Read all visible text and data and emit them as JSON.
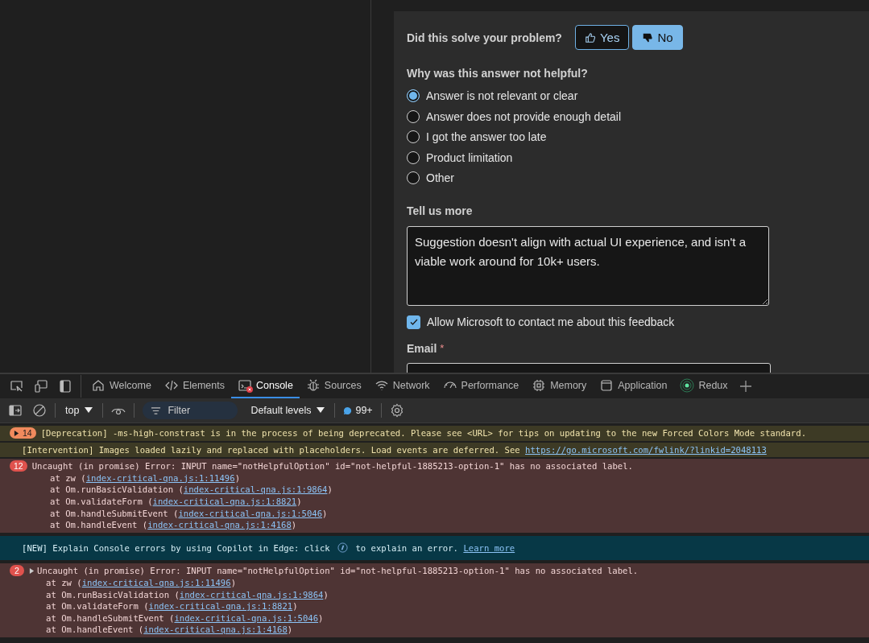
{
  "feedback": {
    "question": "Did this solve your problem?",
    "buttons": [
      {
        "label": "Yes",
        "selected": false
      },
      {
        "label": "No",
        "selected": true
      }
    ],
    "reason_prompt": "Why was this answer not helpful?",
    "reasons": [
      {
        "label": "Answer is not relevant or clear",
        "selected": true
      },
      {
        "label": "Answer does not provide enough detail",
        "selected": false
      },
      {
        "label": "I got the answer too late",
        "selected": false
      },
      {
        "label": "Product limitation",
        "selected": false
      },
      {
        "label": "Other",
        "selected": false
      }
    ],
    "more_label": "Tell us more",
    "more_value": "Suggestion doesn't align with actual UI experience, and isn't a viable work around for 10k+ users.",
    "contact": {
      "label": "Allow Microsoft to contact me about this feedback",
      "checked": true
    },
    "email_label": "Email",
    "email_required_mark": "*"
  },
  "devtools": {
    "tabs": [
      {
        "label": "Welcome",
        "selected": false,
        "error_badge": false
      },
      {
        "label": "Elements",
        "selected": false,
        "error_badge": false
      },
      {
        "label": "Console",
        "selected": true,
        "error_badge": true
      },
      {
        "label": "Sources",
        "selected": false,
        "error_badge": false
      },
      {
        "label": "Network",
        "selected": false,
        "error_badge": false
      },
      {
        "label": "Performance",
        "selected": false,
        "error_badge": false
      },
      {
        "label": "Memory",
        "selected": false,
        "error_badge": false
      },
      {
        "label": "Application",
        "selected": false,
        "error_badge": false
      },
      {
        "label": "Redux",
        "selected": false,
        "error_badge": false
      }
    ],
    "toolbar": {
      "context": "top",
      "filter_placeholder": "Filter",
      "levels": "Default levels",
      "issues_count": "99+"
    },
    "messages": [
      {
        "kind": "warning",
        "count": "14",
        "parts": [
          {
            "kind": "text",
            "text": "[Deprecation] -ms-high-constrast is in the process of being deprecated. Please see <URL> for tips on updating to the new Forced Colors Mode standard."
          }
        ]
      },
      {
        "kind": "warning",
        "parts": [
          {
            "kind": "text",
            "text": "[Intervention] Images loaded lazily and replaced with placeholders. Load events are deferred. See "
          },
          {
            "kind": "link",
            "text": "https://go.microsoft.com/fwlink/?linkid=2048113"
          }
        ]
      },
      {
        "kind": "error",
        "count": "12",
        "expandable": false,
        "parts": [
          {
            "kind": "text",
            "text": "Uncaught (in promise) Error: INPUT name=\"notHelpfulOption\" id=\"not-helpful-1885213-option-1\" has no associated label."
          }
        ],
        "stack": [
          {
            "text": "at zw (",
            "link": "index-critical-qna.js:1:11496",
            "end": ")"
          },
          {
            "text": "at Om.runBasicValidation (",
            "link": "index-critical-qna.js:1:9864",
            "end": ")"
          },
          {
            "text": "at Om.validateForm (",
            "link": "index-critical-qna.js:1:8821",
            "end": ")"
          },
          {
            "text": "at Om.handleSubmitEvent (",
            "link": "index-critical-qna.js:1:5046",
            "end": ")"
          },
          {
            "text": "at Om.handleEvent (",
            "link": "index-critical-qna.js:1:4168",
            "end": ")"
          }
        ]
      },
      {
        "kind": "info",
        "parts": [
          {
            "kind": "text",
            "text": "[NEW] Explain Console errors by using Copilot in Edge: click "
          },
          {
            "kind": "icon"
          },
          {
            "kind": "text",
            "text": " to explain an error. "
          },
          {
            "kind": "link",
            "text": "Learn more"
          }
        ]
      },
      {
        "kind": "error",
        "count": "2",
        "expandable": true,
        "parts": [
          {
            "kind": "text",
            "text": "Uncaught (in promise) Error: INPUT name=\"notHelpfulOption\" id=\"not-helpful-1885213-option-1\" has no associated label."
          }
        ],
        "stack": [
          {
            "text": "at zw (",
            "link": "index-critical-qna.js:1:11496",
            "end": ")"
          },
          {
            "text": "at Om.runBasicValidation (",
            "link": "index-critical-qna.js:1:9864",
            "end": ")"
          },
          {
            "text": "at Om.validateForm (",
            "link": "index-critical-qna.js:1:8821",
            "end": ")"
          },
          {
            "text": "at Om.handleSubmitEvent (",
            "link": "index-critical-qna.js:1:5046",
            "end": ")"
          },
          {
            "text": "at Om.handleEvent (",
            "link": "index-critical-qna.js:1:4168",
            "end": ")"
          }
        ]
      }
    ]
  }
}
